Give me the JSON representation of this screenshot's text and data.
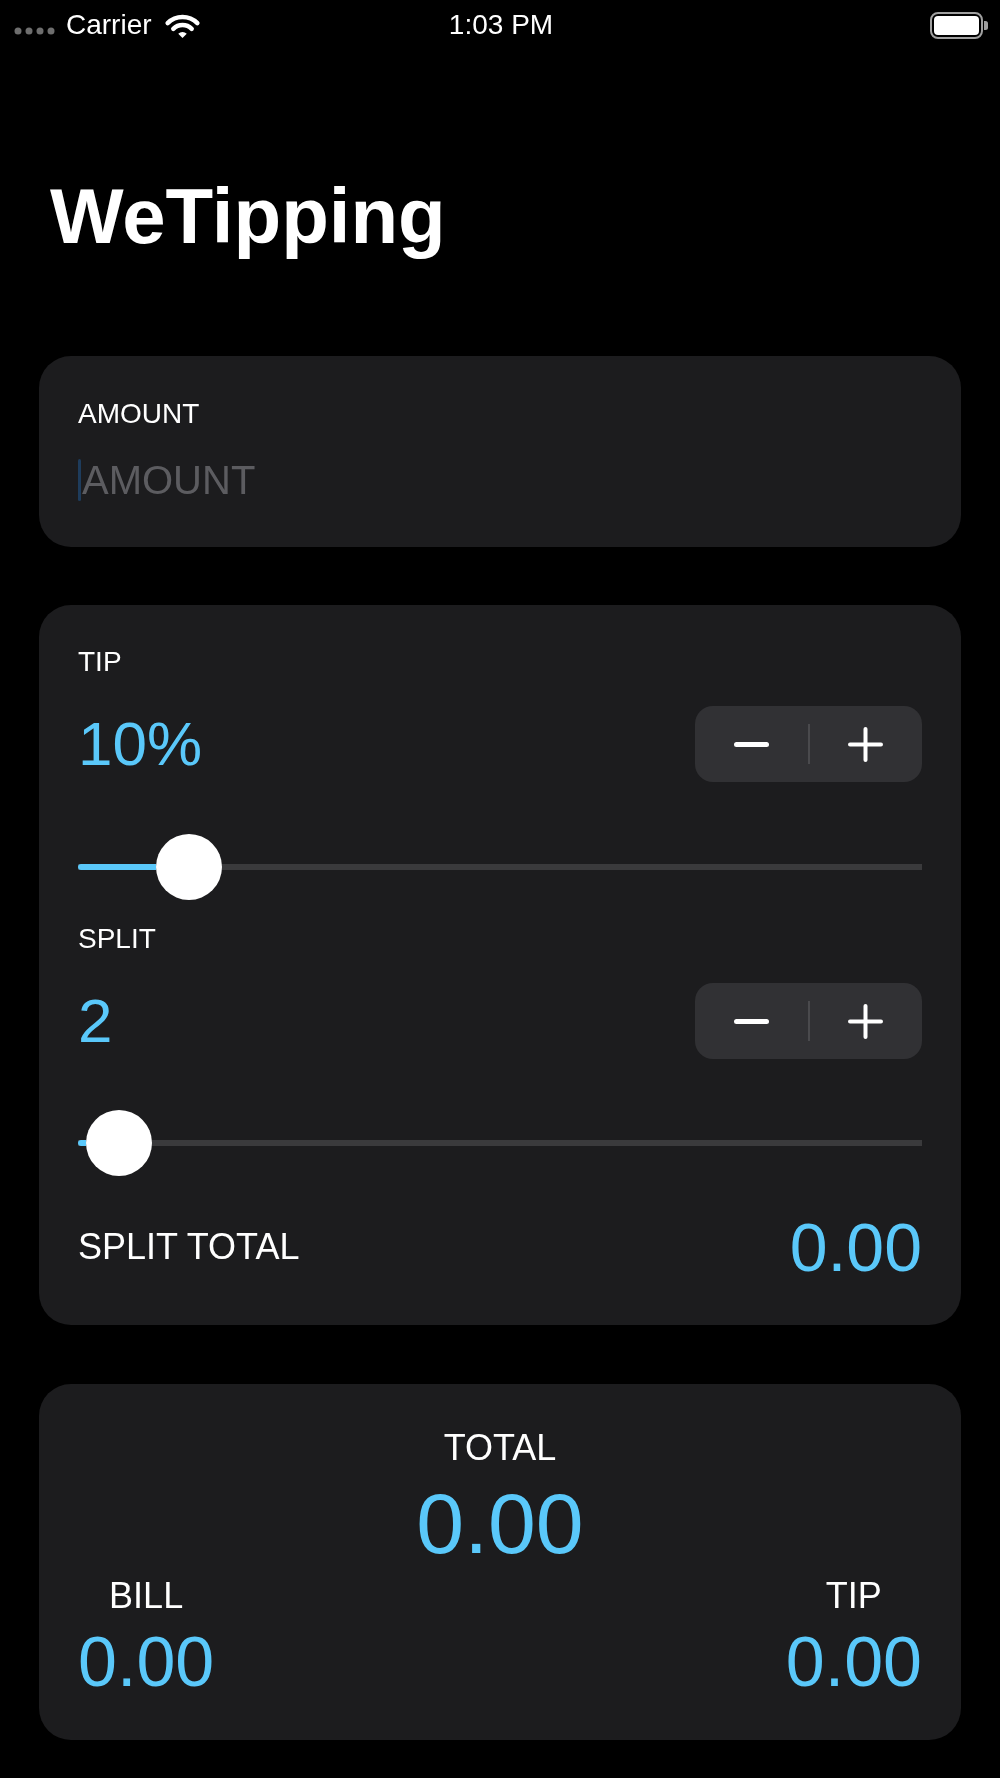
{
  "status_bar": {
    "carrier": "Carrier",
    "time": "1:03 PM"
  },
  "title": "WeTipping",
  "amount": {
    "label": "AMOUNT",
    "placeholder": "AMOUNT",
    "focused": true
  },
  "tip": {
    "label": "TIP",
    "value": "10%",
    "level": 0.1
  },
  "split": {
    "label": "SPLIT",
    "value": "2",
    "level": 0.01
  },
  "split_total": {
    "label": "SPLIT TOTAL",
    "value": "0.00"
  },
  "summary": {
    "total": {
      "label": "TOTAL",
      "value": "0.00"
    },
    "bill": {
      "label": "BILL",
      "value": "0.00"
    },
    "tip": {
      "label": "TIP",
      "value": "0.00"
    }
  }
}
